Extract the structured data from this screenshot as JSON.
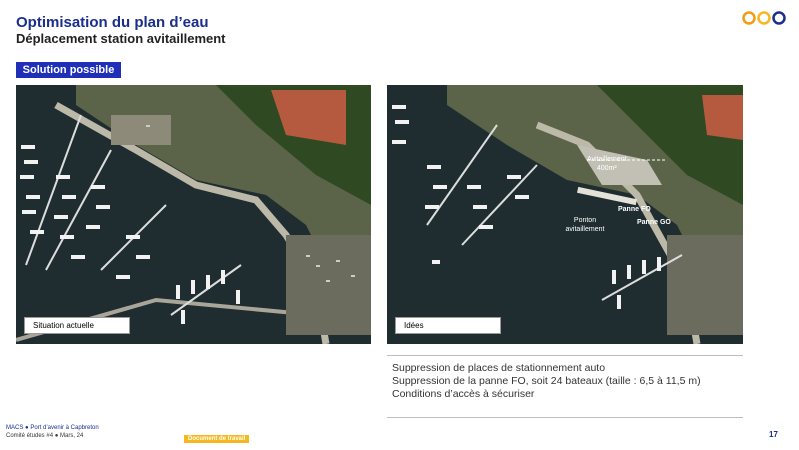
{
  "header": {
    "title": "Optimisation du plan d’eau",
    "subtitle": "Déplacement station avitaillement"
  },
  "badge": {
    "label": "Solution possible"
  },
  "left_photo": {
    "caption": "Situation actuelle"
  },
  "right_photo": {
    "caption": "Idées",
    "annotations": {
      "avitaillement": "Avitaillement",
      "distance": "400m²",
      "panne_fo": "Panne FO",
      "panne_go": "Panne GO",
      "ponton": "Ponton avitaillement"
    }
  },
  "bullets": [
    "Suppression de places de stationnement auto",
    "Suppression de la panne FO, soit 24 bateaux (taille  : 6,5 à 11,5 m)",
    "Conditions d’accès à sécuriser"
  ],
  "footer": {
    "line1_org": "MACS",
    "line1_project": "Port d’avenir à Capbreton",
    "line2_meeting": "Comité études #4",
    "line2_date": "Mars, 24",
    "doc_badge": "Document de travail",
    "page_number": "17"
  },
  "colors": {
    "brand_blue": "#1a2e8c",
    "badge_blue": "#1f2fb8",
    "logo_orange": "#f39c12",
    "logo_yellow": "#f5b81f",
    "logo_navy": "#1a2e8c"
  }
}
